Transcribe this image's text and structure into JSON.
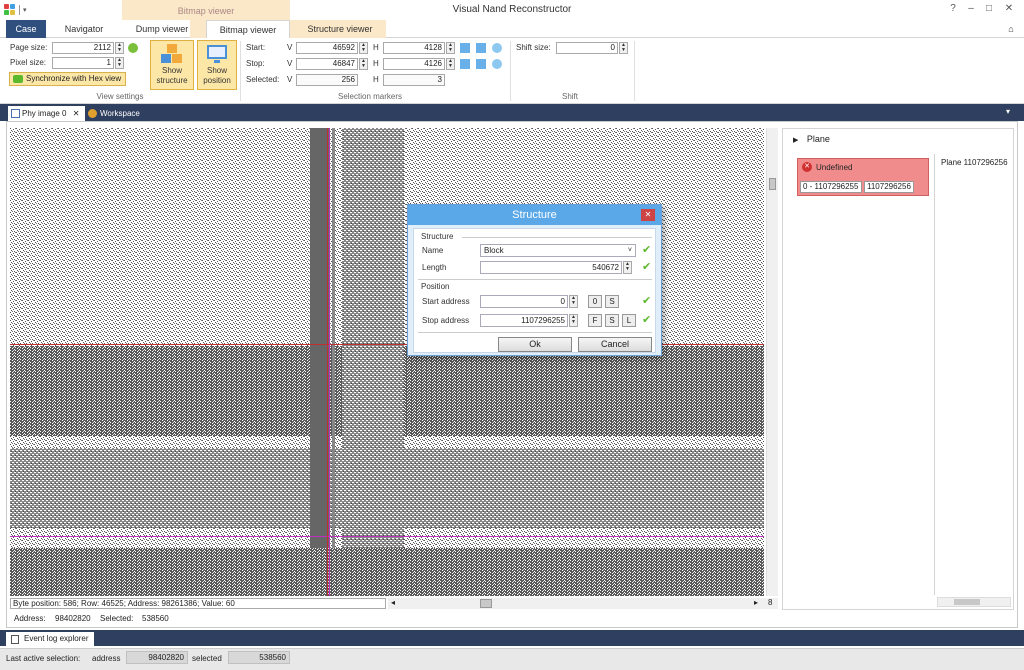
{
  "window": {
    "title": "Visual Nand Reconstructor",
    "context_tab_label": "Bitmap viewer"
  },
  "ribbon_tabs": [
    {
      "label": "Case"
    },
    {
      "label": "Navigator"
    },
    {
      "label": "Dump viewer"
    },
    {
      "label": "Bitmap viewer"
    },
    {
      "label": "Structure viewer"
    }
  ],
  "view_settings": {
    "group_label": "View settings",
    "page_size_label": "Page size:",
    "page_size_value": "2112",
    "pixel_size_label": "Pixel size:",
    "pixel_size_value": "1",
    "sync_button": "Synchronize with Hex view",
    "show_structure": "Show structure",
    "show_position": "Show position"
  },
  "selection_markers": {
    "group_label": "Selection markers",
    "start_label": "Start:",
    "stop_label": "Stop:",
    "selected_label": "Selected:",
    "v_label": "V",
    "h_label": "H",
    "start_v": "46592",
    "start_h": "4128",
    "stop_v": "46847",
    "stop_h": "4126",
    "selected_v": "256",
    "selected_h": "3"
  },
  "shift": {
    "group_label": "Shift",
    "shift_size_label": "Shift size:",
    "shift_size_value": "0"
  },
  "doc_tabs": [
    {
      "label": "Phy image 0"
    },
    {
      "label": "Workspace"
    }
  ],
  "bitmap_status": {
    "byte_position": "Byte position: 586; Row: 46525; Address: 98261386; Value: 60",
    "address_label": "Address:",
    "address_value": "98402820",
    "selected_label": "Selected:",
    "selected_value": "538560",
    "scroll_value": "8"
  },
  "right_panel": {
    "plane_header": "Plane",
    "undefined_label": "Undefined",
    "range_text": "0 - 1107296255",
    "range_value": "1107296256",
    "plane_entry": "Plane 1107296256"
  },
  "dialog": {
    "title": "Structure",
    "structure_section": "Structure",
    "name_label": "Name",
    "name_value": "Block",
    "length_label": "Length",
    "length_value": "540672",
    "position_section": "Position",
    "start_label": "Start address",
    "start_value": "0",
    "stop_label": "Stop address",
    "stop_value": "1107296255",
    "btn_0": "0",
    "btn_s": "S",
    "btn_f": "F",
    "btn_s2": "S",
    "btn_l": "L",
    "ok": "Ok",
    "cancel": "Cancel"
  },
  "event_log": {
    "label": "Event log explorer"
  },
  "statusbar": {
    "last_active_label": "Last active selection:",
    "address_label": "address",
    "address_value": "98402820",
    "selected_label": "selected",
    "selected_value": "538560"
  },
  "colors": {
    "file_tab": "#2f4f7f",
    "context_tab": "#fbe8c8",
    "dialog_title": "#5aa8e8",
    "undefined_box": "#f08c8c",
    "check": "#5cb82c"
  }
}
